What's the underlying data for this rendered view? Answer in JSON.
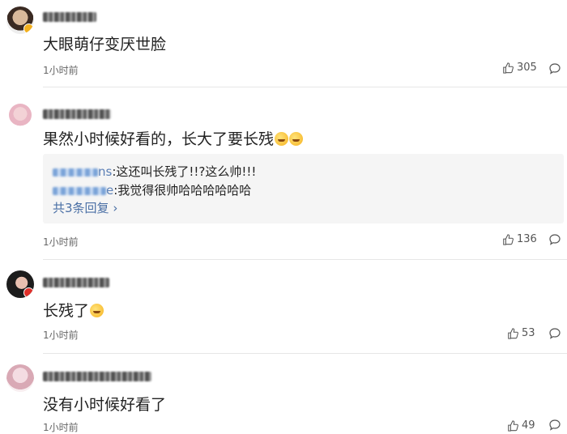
{
  "comments": [
    {
      "username": "",
      "text": "大眼萌仔变厌世脸",
      "time": "1小时前",
      "likes": "305"
    },
    {
      "username": "",
      "text": "果然小时候好看的，长大了要长残",
      "time": "1小时前",
      "likes": "136",
      "replies": [
        {
          "name_suffix": "ns",
          "text": ":这还叫长残了!!?这么帅!!!"
        },
        {
          "name_suffix": "e",
          "text": ":我觉得很帅哈哈哈哈哈哈"
        }
      ],
      "more_replies": "共3条回复"
    },
    {
      "username": "",
      "text": "长残了",
      "time": "1小时前",
      "likes": "53"
    },
    {
      "username": "",
      "text": "没有小时候好看了",
      "time": "1小时前",
      "likes": "49"
    }
  ],
  "icons": {
    "like": "thumbs-up-icon",
    "reply": "comment-bubble-icon",
    "emoji": "crying-laugh-emoji"
  },
  "colors": {
    "link": "#4a6fa5",
    "divider": "#e6e6e6",
    "reply_bg": "#f5f5f5"
  }
}
